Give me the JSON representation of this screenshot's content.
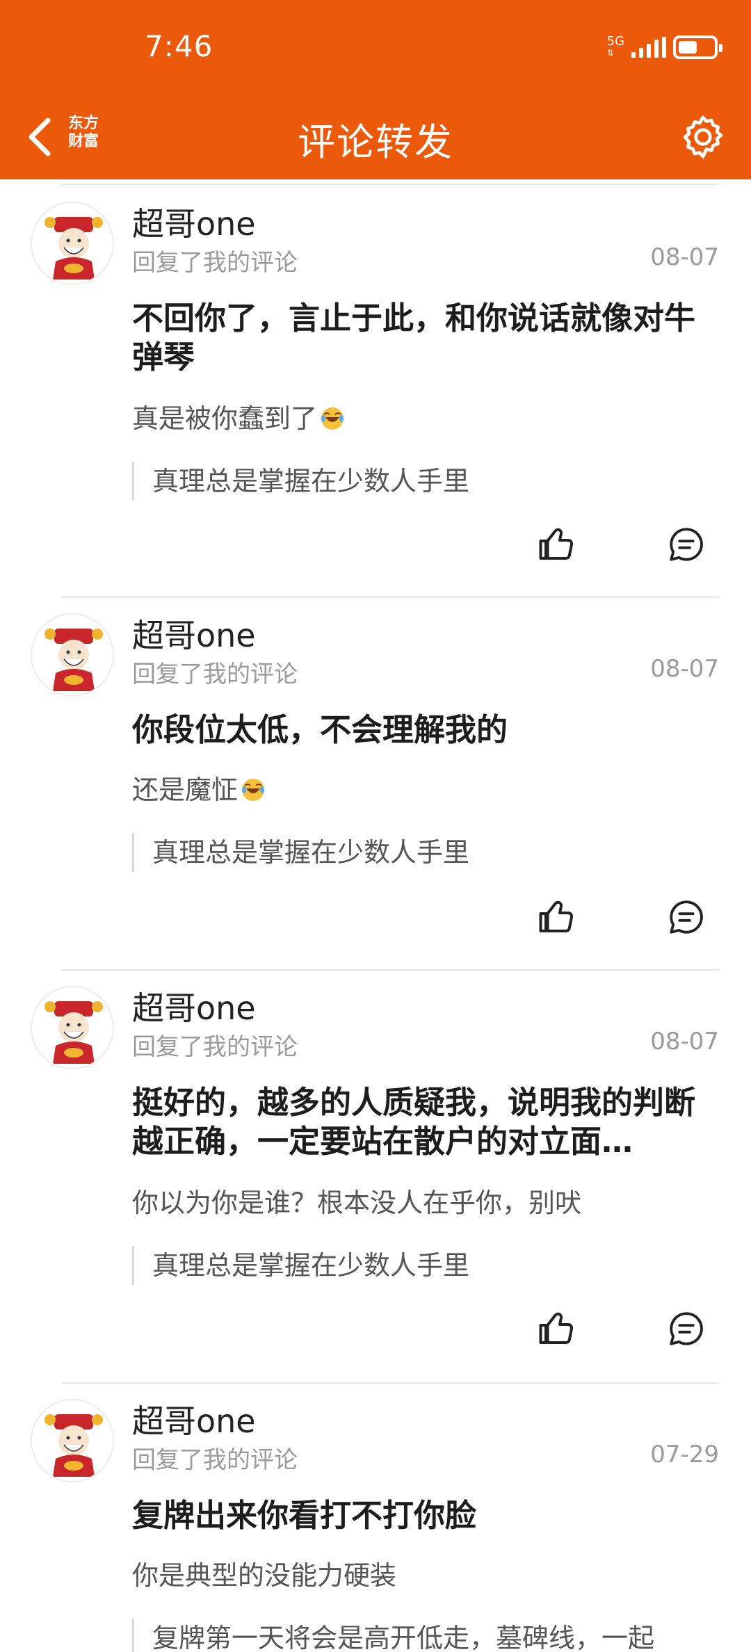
{
  "status_bar": {
    "time": "7:46",
    "network": "5G"
  },
  "header": {
    "logo_line1": "东方",
    "logo_line2": "财富",
    "title": "评论转发"
  },
  "comments": [
    {
      "user": "超哥one",
      "action": "回复了我的评论",
      "date": "08-07",
      "content": "不回你了，言止于此，和你说话就像对牛弹琴",
      "reply": "真是被你蠢到了",
      "reply_emoji": "laugh-cry-icon",
      "quote": "真理总是掌握在少数人手里"
    },
    {
      "user": "超哥one",
      "action": "回复了我的评论",
      "date": "08-07",
      "content": "你段位太低，不会理解我的",
      "reply": "还是魔怔",
      "reply_emoji": "laugh-cry-icon",
      "quote": "真理总是掌握在少数人手里"
    },
    {
      "user": "超哥one",
      "action": "回复了我的评论",
      "date": "08-07",
      "content": "挺好的，越多的人质疑我，说明我的判断越正确，一定要站在散户的对立面…",
      "reply": "你以为你是谁？根本没人在乎你，别吠",
      "quote": "真理总是掌握在少数人手里"
    },
    {
      "user": "超哥one",
      "action": "回复了我的评论",
      "date": "07-29",
      "content": "复牌出来你看打不打你脸",
      "reply": "你是典型的没能力硬装",
      "quote": "复牌第一天将会是高开低走，墓碑线，一起"
    }
  ],
  "colors": {
    "brand": "#ea5a0a",
    "muted_text": "#9a9a9a"
  }
}
